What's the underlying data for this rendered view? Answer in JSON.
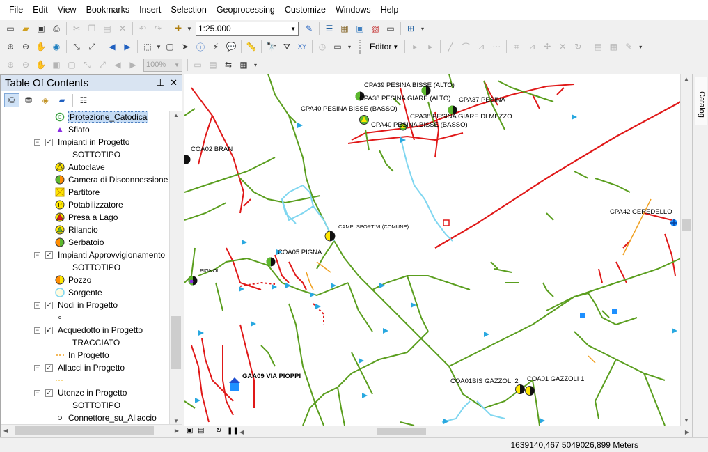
{
  "menu": [
    "File",
    "Edit",
    "View",
    "Bookmarks",
    "Insert",
    "Selection",
    "Geoprocessing",
    "Customize",
    "Windows",
    "Help"
  ],
  "toolbar": {
    "scale": "1:25.000",
    "zoom": "100%",
    "editor_label": "Editor"
  },
  "toc": {
    "title": "Table Of Contents",
    "rows": [
      {
        "label": "Protezione_Catodica",
        "selected": true
      },
      {
        "label": "Sfiato"
      },
      {
        "label": "Impianti in Progetto"
      },
      {
        "label": "SOTTOTIPO"
      },
      {
        "label": "Autoclave"
      },
      {
        "label": "Camera di Disconnessione"
      },
      {
        "label": "Partitore"
      },
      {
        "label": "Potabilizzatore"
      },
      {
        "label": "Presa a Lago"
      },
      {
        "label": "Rilancio"
      },
      {
        "label": "Serbatoio"
      },
      {
        "label": "Impianti Approvvigionamento"
      },
      {
        "label": "SOTTOTIPO"
      },
      {
        "label": "Pozzo"
      },
      {
        "label": "Sorgente"
      },
      {
        "label": "Nodi in Progetto"
      },
      {
        "label": "Acquedotto in Progetto"
      },
      {
        "label": "TRACCIATO"
      },
      {
        "label": "In Progetto"
      },
      {
        "label": "Allacci in Progetto"
      },
      {
        "label": "Utenze in Progetto"
      },
      {
        "label": "SOTTOTIPO"
      },
      {
        "label": "Connettore_su_Allaccio"
      }
    ]
  },
  "map": {
    "labels": [
      "CPA39 PESINA BISSE (ALTO)",
      "CPA38 PESINA GIARE (ALTO)",
      "CPA37 PESINA",
      "CPA40 PESINA BISSE (BASSO)",
      "CPA38 PESINA GIARE DI MEZZO",
      "CPA40 PESINA BISSE (BASSO)",
      "COA02 BRAN",
      "CAMPI SPORTIVI (COMUNE)",
      "CPA42 CEREDELLO",
      "COA05 PIGNA",
      "PIGNOI",
      "GAA09 VIA PIOPPI",
      "COA01BIS GAZZOLI 2",
      "COA01 GAZZOLI 1"
    ]
  },
  "catalog_label": "Catalog",
  "status": {
    "coordinates": "1639140,467  5049026,899 Meters"
  },
  "colors": {
    "toc_title_bg": "#d9e4f2",
    "pipe_green": "#5a9e1e",
    "pipe_red": "#e01818",
    "pipe_cyan": "#7fd6f0",
    "pipe_orange": "#f0a020",
    "marker_blue": "#1e90ff"
  }
}
